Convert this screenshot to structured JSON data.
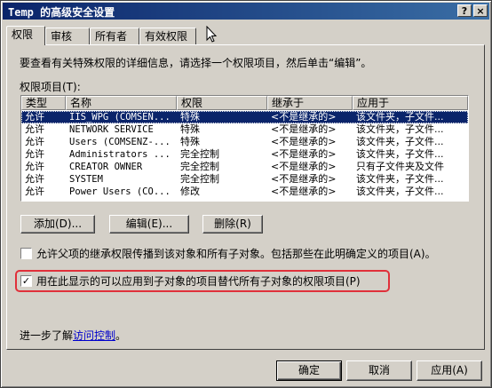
{
  "window": {
    "title": "Temp 的高级安全设置"
  },
  "titlebar_buttons": {
    "help": "?",
    "close": "×"
  },
  "tabs": [
    {
      "label": "权限"
    },
    {
      "label": "审核"
    },
    {
      "label": "所有者"
    },
    {
      "label": "有效权限"
    }
  ],
  "instruction": "要查看有关特殊权限的详细信息，请选择一个权限项目，然后单击“编辑”。",
  "list_label": "权限项目(T):",
  "columns": [
    "类型",
    "名称",
    "权限",
    "继承于",
    "应用于"
  ],
  "rows": [
    {
      "type": "允许",
      "name": "IIS_WPG (COMSEN...",
      "perm": "特殊",
      "inherit": "<不是继承的>",
      "apply": "该文件夹，子文件...",
      "selected": true
    },
    {
      "type": "允许",
      "name": "NETWORK SERVICE",
      "perm": "特殊",
      "inherit": "<不是继承的>",
      "apply": "该文件夹，子文件..."
    },
    {
      "type": "允许",
      "name": "Users (COMSENZ-...",
      "perm": "特殊",
      "inherit": "<不是继承的>",
      "apply": "该文件夹，子文件..."
    },
    {
      "type": "允许",
      "name": "Administrators ...",
      "perm": "完全控制",
      "inherit": "<不是继承的>",
      "apply": "该文件夹，子文件..."
    },
    {
      "type": "允许",
      "name": "CREATOR OWNER",
      "perm": "完全控制",
      "inherit": "<不是继承的>",
      "apply": "只有子文件夹及文件"
    },
    {
      "type": "允许",
      "name": "SYSTEM",
      "perm": "完全控制",
      "inherit": "<不是继承的>",
      "apply": "该文件夹，子文件..."
    },
    {
      "type": "允许",
      "name": "Power Users (CO...",
      "perm": "修改",
      "inherit": "<不是继承的>",
      "apply": "该文件夹，子文件..."
    }
  ],
  "buttons": {
    "add": "添加(D)...",
    "edit": "编辑(E)...",
    "remove": "删除(R)"
  },
  "checkbox_inherit": {
    "label": "允许父项的继承权限传播到该对象和所有子对象。包括那些在此明确定义的项目(A)。",
    "checked": false
  },
  "checkbox_replace": {
    "label": "用在此显示的可以应用到子对象的项目替代所有子对象的权限项目(P)",
    "checked": true,
    "mark": "✓"
  },
  "learn_more": {
    "prefix": "进一步了解",
    "link": "访问控制",
    "suffix": "。"
  },
  "footer": {
    "ok": "确定",
    "cancel": "取消",
    "apply": "应用(A)"
  }
}
